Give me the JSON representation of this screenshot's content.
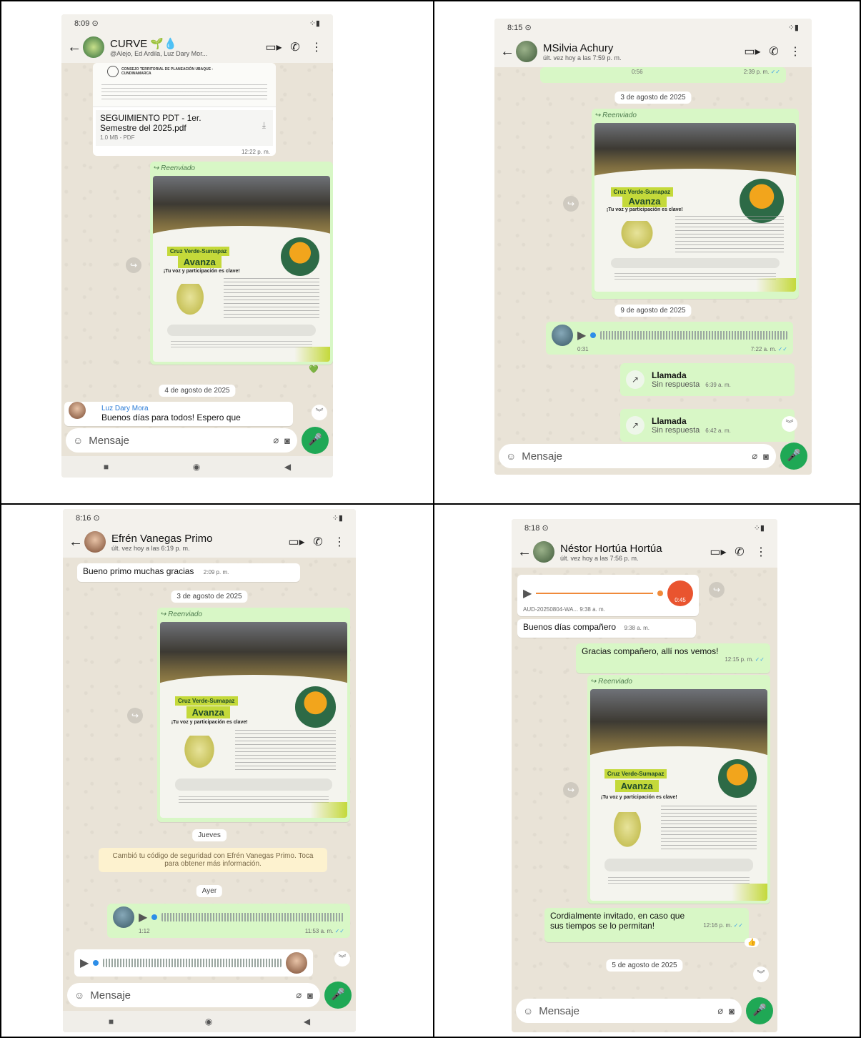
{
  "p1": {
    "time": "8:09",
    "chat_name": "CURVE 🌱💧",
    "chat_sub": "@Alejo, Ed Ardila, Luz Dary Mor...",
    "pdf_org": "CONSEJO TERRITORIAL DE PLANEACIÓN UBAQUE - CUNDINAMARCA",
    "pdf_name": "SEGUIMIENTO PDT - 1er. Semestre del  2025.pdf",
    "pdf_size": "1.0 MB - PDF",
    "pdf_time": "12:22 p. m.",
    "forwarded": "Reenviado",
    "poster_tag": "Cruz Verde-Sumapaz",
    "poster_title": "Avanza",
    "poster_lead": "¡Tu voz y participación es clave!",
    "date": "4 de agosto de 2025",
    "sender": "Luz Dary Mora",
    "message": "Buenos días para todos!  Espero que",
    "input_placeholder": "Mensaje"
  },
  "p2": {
    "time": "8:15",
    "chat_name": "MSilvia Achury",
    "chat_sub": "últ. vez hoy a las 7:59 p. m.",
    "top_duration": "0:56",
    "top_time": "2:39 p. m.",
    "date1": "3 de agosto de 2025",
    "forwarded": "Reenviado",
    "poster_tag": "Cruz Verde-Sumapaz",
    "poster_title": "Avanza",
    "poster_lead": "¡Tu voz y participación es clave!",
    "date2": "9 de agosto de 2025",
    "audio_duration": "0:31",
    "audio_time": "7:22 a. m.",
    "call1_title": "Llamada",
    "call1_status": "Sin respuesta",
    "call1_time": "6:39 a. m.",
    "call2_title": "Llamada",
    "call2_status": "Sin respuesta",
    "call2_time": "6:42 a. m.",
    "input_placeholder": "Mensaje"
  },
  "p3": {
    "time": "8:16",
    "chat_name": "Efrén Vanegas Primo",
    "chat_sub": "últ. vez hoy a las 6:19 p. m.",
    "msg1": "Bueno primo muchas gracias",
    "msg1_time": "2:09 p. m.",
    "date1": "3 de agosto de 2025",
    "forwarded": "Reenviado",
    "poster_tag": "Cruz Verde-Sumapaz",
    "poster_title": "Avanza",
    "poster_lead": "¡Tu voz y participación es clave!",
    "date2": "Jueves",
    "system_msg": "Cambió tu código de seguridad con Efrén Vanegas Primo. Toca para obtener más información.",
    "date3": "Ayer",
    "audio_duration": "1:12",
    "audio_time": "11:53 a. m.",
    "input_placeholder": "Mensaje"
  },
  "p4": {
    "time": "8:18",
    "chat_name": "Néstor Hortúa Hortúa",
    "chat_sub": "últ. vez hoy a las 7:56 p. m.",
    "audio_file": "AUD-20250804-WA...",
    "audio_time": "9:38 a. m.",
    "audio_badge": "0:45",
    "msg1": "Buenos días compañero",
    "msg1_time": "9:38 a. m.",
    "msg2": "Gracias compañero, allí nos vemos!",
    "msg2_time": "12:15 p. m.",
    "forwarded": "Reenviado",
    "poster_tag": "Cruz Verde-Sumapaz",
    "poster_title": "Avanza",
    "poster_lead": "¡Tu voz y participación es clave!",
    "msg3": "Cordialmente invitado, en caso que sus tiempos se lo permitan!",
    "msg3_time": "12:16 p. m.",
    "reaction": "👍",
    "date": "5 de agosto de 2025",
    "input_placeholder": "Mensaje"
  },
  "glyphs": {
    "back": "←",
    "video": "▭▸",
    "phone": "✆",
    "more": "⋮",
    "forward": "↪",
    "play": "▶",
    "mic": "🎤",
    "emoji": "☺",
    "attach": "⌀",
    "camera": "◙",
    "nav_square": "■",
    "nav_home": "◉",
    "nav_back": "◀",
    "scroll_down": "︾",
    "call_missed": "↗",
    "download": "⤓",
    "heart": "💚",
    "check": "✓✓",
    "signal": "⁘▮",
    "wa_status": "⊙"
  },
  "colors": {
    "accent_green": "#1fa855",
    "bubble_out": "#d8f7c6",
    "chat_bg": "#e9e3d7"
  }
}
